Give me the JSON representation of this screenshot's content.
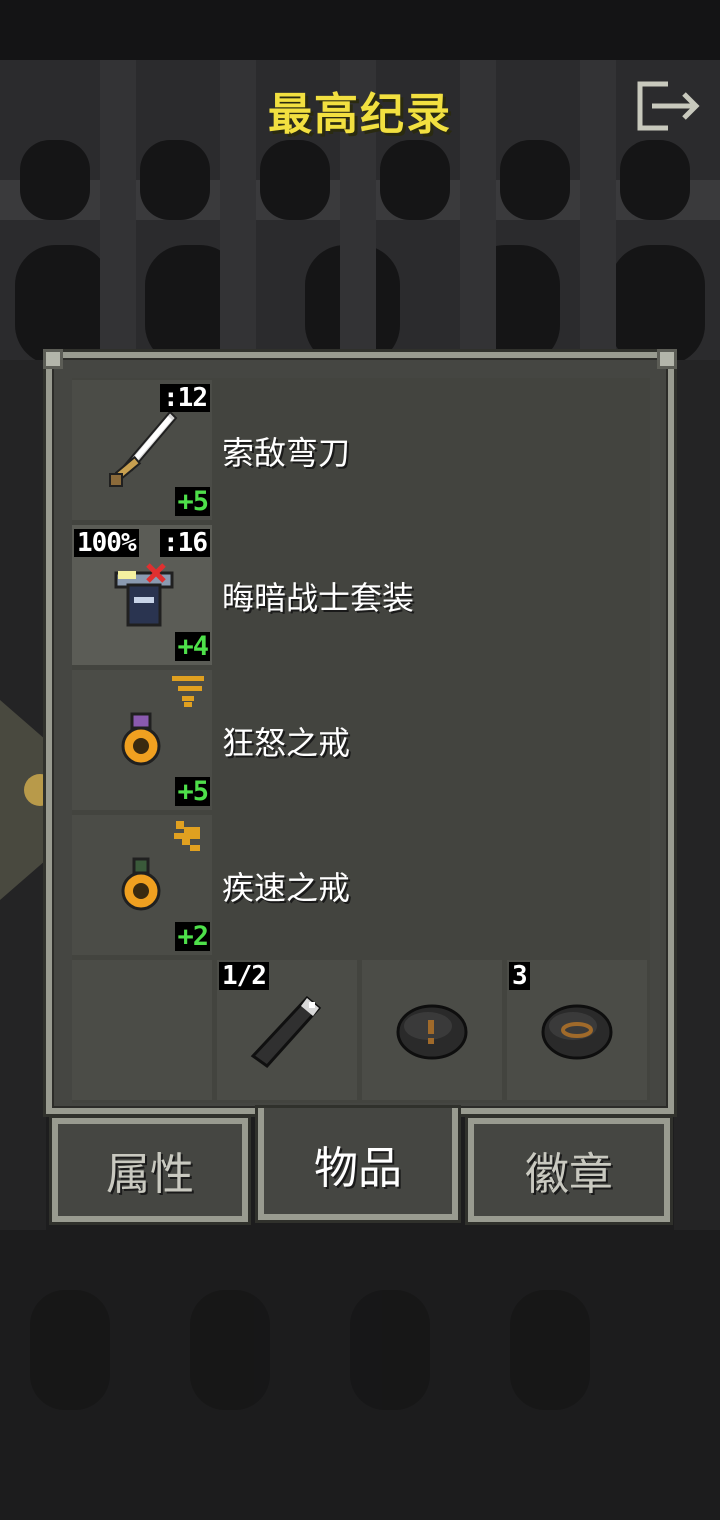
{
  "header": {
    "title": "最高纪录",
    "exit_icon": "exit-icon"
  },
  "items": [
    {
      "name": "索敌弯刀",
      "icon": "sword-icon",
      "top_right": ":12",
      "level": "+5",
      "selected": false
    },
    {
      "name": "晦暗战士套装",
      "icon": "armor-icon",
      "top_left": "100%",
      "top_right": ":16",
      "level": "+4",
      "selected": true
    },
    {
      "name": "狂怒之戒",
      "icon": "ring-icon",
      "glyph": "fury-glyph-icon",
      "level": "+5",
      "selected": false
    },
    {
      "name": "疾速之戒",
      "icon": "ring-icon",
      "glyph": "haste-glyph-icon",
      "level": "+2",
      "selected": false
    }
  ],
  "quickslots": [
    {
      "icon": "",
      "badge": ""
    },
    {
      "icon": "wand-icon",
      "badge": "1/2"
    },
    {
      "icon": "stone-icon",
      "badge": ""
    },
    {
      "icon": "stone-eye-icon",
      "badge": "3"
    }
  ],
  "tabs": [
    {
      "label": "属性",
      "active": false
    },
    {
      "label": "物品",
      "active": true
    },
    {
      "label": "徽章",
      "active": false
    }
  ],
  "colors": {
    "title": "#f2e040",
    "level": "#4ee04a",
    "panel": "#454642",
    "border": "#999b90"
  }
}
